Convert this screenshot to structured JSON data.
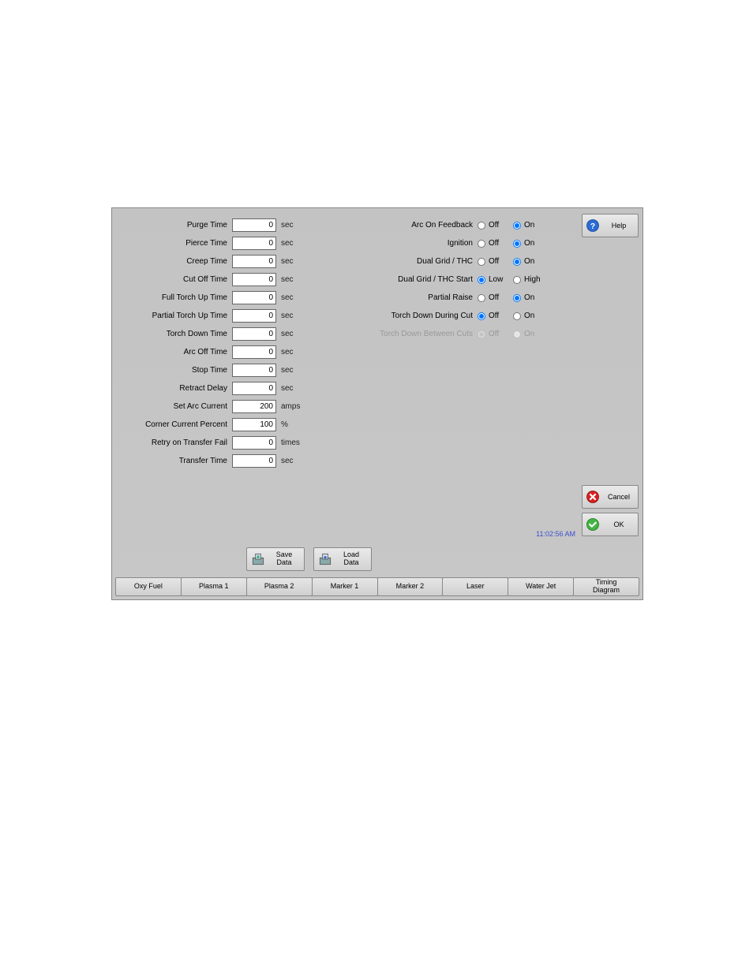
{
  "params": [
    {
      "label": "Purge Time",
      "value": "0",
      "unit": "sec"
    },
    {
      "label": "Pierce Time",
      "value": "0",
      "unit": "sec"
    },
    {
      "label": "Creep Time",
      "value": "0",
      "unit": "sec"
    },
    {
      "label": "Cut Off Time",
      "value": "0",
      "unit": "sec"
    },
    {
      "label": "Full Torch Up Time",
      "value": "0",
      "unit": "sec"
    },
    {
      "label": "Partial Torch Up Time",
      "value": "0",
      "unit": "sec"
    },
    {
      "label": "Torch Down Time",
      "value": "0",
      "unit": "sec"
    },
    {
      "label": "Arc Off Time",
      "value": "0",
      "unit": "sec"
    },
    {
      "label": "Stop Time",
      "value": "0",
      "unit": "sec"
    },
    {
      "label": "Retract Delay",
      "value": "0",
      "unit": "sec"
    },
    {
      "label": "Set Arc Current",
      "value": "200",
      "unit": "amps"
    },
    {
      "label": "Corner Current Percent",
      "value": "100",
      "unit": "%"
    },
    {
      "label": "Retry on Transfer Fail",
      "value": "0",
      "unit": "times"
    },
    {
      "label": "Transfer Time",
      "value": "0",
      "unit": "sec"
    }
  ],
  "radios": [
    {
      "label": "Arc On Feedback",
      "opt1": "Off",
      "opt2": "On",
      "sel": 2,
      "disabled": false
    },
    {
      "label": "Ignition",
      "opt1": "Off",
      "opt2": "On",
      "sel": 2,
      "disabled": false
    },
    {
      "label": "Dual Grid / THC",
      "opt1": "Off",
      "opt2": "On",
      "sel": 2,
      "disabled": false
    },
    {
      "label": "Dual Grid / THC Start",
      "opt1": "Low",
      "opt2": "High",
      "sel": 1,
      "disabled": false
    },
    {
      "label": "Partial Raise",
      "opt1": "Off",
      "opt2": "On",
      "sel": 2,
      "disabled": false
    },
    {
      "label": "Torch Down During Cut",
      "opt1": "Off",
      "opt2": "On",
      "sel": 1,
      "disabled": false
    },
    {
      "label": "Torch Down Between Cuts",
      "opt1": "Off",
      "opt2": "On",
      "sel": 1,
      "disabled": true
    }
  ],
  "side": {
    "help": "Help",
    "cancel": "Cancel",
    "ok": "OK"
  },
  "mid": {
    "save": "Save\nData",
    "load": "Load\nData"
  },
  "time": "11:02:56 AM",
  "tabs": [
    "Oxy Fuel",
    "Plasma 1",
    "Plasma 2",
    "Marker 1",
    "Marker 2",
    "Laser",
    "Water Jet",
    "Timing\nDiagram"
  ]
}
